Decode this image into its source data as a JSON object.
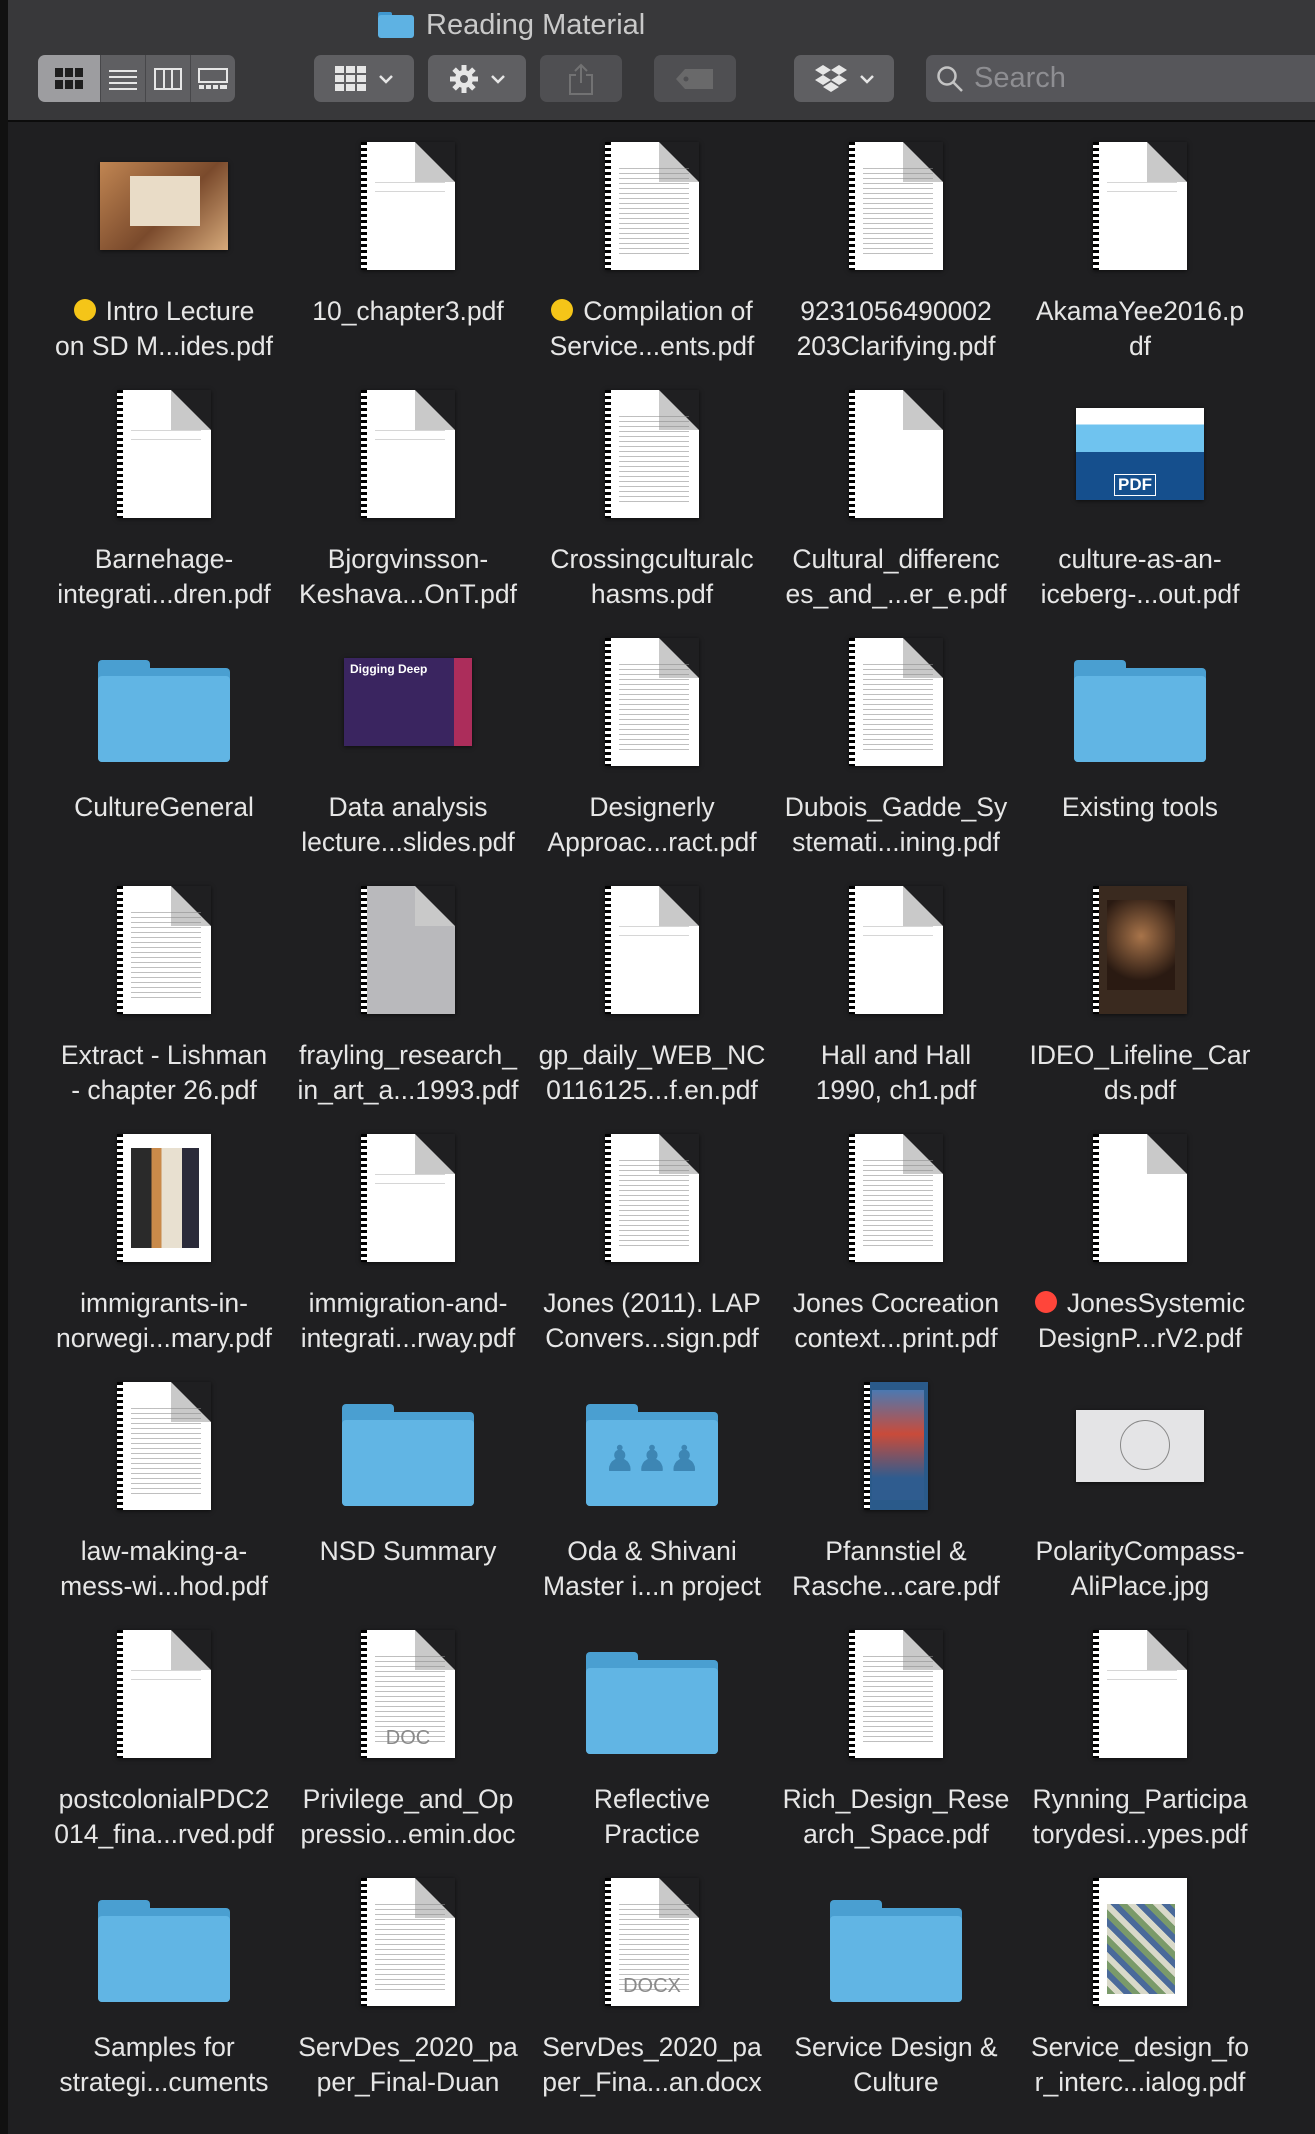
{
  "window": {
    "title": "Reading Material"
  },
  "toolbar": {
    "view_modes": [
      "icon-view",
      "list-view",
      "column-view",
      "gallery-view"
    ],
    "active_view": "icon-view",
    "search": {
      "placeholder": "Search",
      "value": ""
    }
  },
  "items": [
    {
      "label": "Intro Lecture\non SD M...ides.pdf",
      "kind": "slide",
      "tag": "yellow"
    },
    {
      "label": "10_chapter3.pdf",
      "kind": "doc",
      "lines": "sparse"
    },
    {
      "label": "Compilation of\nService...ents.pdf",
      "kind": "doc",
      "lines": "dense",
      "tag": "yellow"
    },
    {
      "label": "9231056490002\n203Clarifying.pdf",
      "kind": "doc",
      "lines": "dense"
    },
    {
      "label": "AkamaYee2016.p\ndf",
      "kind": "doc",
      "lines": "sparse"
    },
    {
      "label": "Barnehage-\nintegrati...dren.pdf",
      "kind": "doc",
      "lines": "sparse"
    },
    {
      "label": "Bjorgvinsson-\nKeshava...OnT.pdf",
      "kind": "doc",
      "lines": "sparse"
    },
    {
      "label": "Crossingculturalc\nhasms.pdf",
      "kind": "doc",
      "lines": "dense"
    },
    {
      "label": "Cultural_differenc\nes_and_...er_e.pdf",
      "kind": "doc",
      "lines": "blank"
    },
    {
      "label": "culture-as-an-\niceberg-...out.pdf",
      "kind": "iceberg"
    },
    {
      "label": "CultureGeneral",
      "kind": "folder"
    },
    {
      "label": "Data analysis\nlecture...slides.pdf",
      "kind": "cover",
      "cover_title": "Digging Deep"
    },
    {
      "label": "Designerly\nApproac...ract.pdf",
      "kind": "doc",
      "lines": "dense"
    },
    {
      "label": "Dubois_Gadde_Sy\nstemati...ining.pdf",
      "kind": "doc",
      "lines": "dense"
    },
    {
      "label": "Existing tools",
      "kind": "folder"
    },
    {
      "label": "Extract - Lishman\n- chapter 26.pdf",
      "kind": "doc",
      "lines": "dense"
    },
    {
      "label": "frayling_research_\nin_art_a...1993.pdf",
      "kind": "doc",
      "lines": "grey"
    },
    {
      "label": "gp_daily_WEB_NC\n0116125...f.en.pdf",
      "kind": "doc",
      "lines": "sparse"
    },
    {
      "label": "Hall and Hall\n1990, ch1.pdf",
      "kind": "doc",
      "lines": "sparse"
    },
    {
      "label": "IDEO_Lifeline_Car\nds.pdf",
      "kind": "photo-dark"
    },
    {
      "label": "immigrants-in-\nnorwegi...mary.pdf",
      "kind": "photo-people"
    },
    {
      "label": "immigration-and-\nintegrati...rway.pdf",
      "kind": "doc",
      "lines": "sparse"
    },
    {
      "label": "Jones (2011). LAP\nConvers...sign.pdf",
      "kind": "doc",
      "lines": "dense"
    },
    {
      "label": "Jones Cocreation\ncontext...print.pdf",
      "kind": "doc",
      "lines": "dense"
    },
    {
      "label": "JonesSystemic\nDesignP...rV2.pdf",
      "kind": "doc",
      "lines": "blank",
      "tag": "red"
    },
    {
      "label": "law-making-a-\nmess-wi...hod.pdf",
      "kind": "doc",
      "lines": "dense"
    },
    {
      "label": "NSD Summary",
      "kind": "folder"
    },
    {
      "label": "Oda & Shivani\nMaster i...n project",
      "kind": "folder",
      "glyph": "people"
    },
    {
      "label": "Pfannstiel &\nRasche...care.pdf",
      "kind": "photo-book"
    },
    {
      "label": "PolarityCompass-\nAliPlace.jpg",
      "kind": "polar"
    },
    {
      "label": "postcolonialPDC2\n014_fina...rved.pdf",
      "kind": "doc",
      "lines": "sparse"
    },
    {
      "label": "Privilege_and_Op\npressio...emin.doc",
      "kind": "doc",
      "lines": "dense",
      "ext": "DOC"
    },
    {
      "label": "Reflective\nPractice",
      "kind": "folder"
    },
    {
      "label": "Rich_Design_Rese\narch_Space.pdf",
      "kind": "doc",
      "lines": "dense"
    },
    {
      "label": "Rynning_Participa\ntorydesi...ypes.pdf",
      "kind": "doc",
      "lines": "sparse"
    },
    {
      "label": "Samples for\nstrategi...cuments",
      "kind": "folder"
    },
    {
      "label": "ServDes_2020_pa\nper_Final-Duan",
      "kind": "doc",
      "lines": "dense"
    },
    {
      "label": "ServDes_2020_pa\nper_Fina...an.docx",
      "kind": "doc",
      "lines": "dense",
      "ext": "DOCX"
    },
    {
      "label": "Service Design &\nCulture",
      "kind": "folder"
    },
    {
      "label": "Service_design_fo\nr_interc...ialog.pdf",
      "kind": "photo-poster"
    }
  ],
  "colors": {
    "tag_yellow": "#f5c518",
    "tag_red": "#ff453a",
    "folder_blue": "#61b5e4",
    "toolbar_bg": "#38383a",
    "content_bg": "#1f1f21"
  }
}
